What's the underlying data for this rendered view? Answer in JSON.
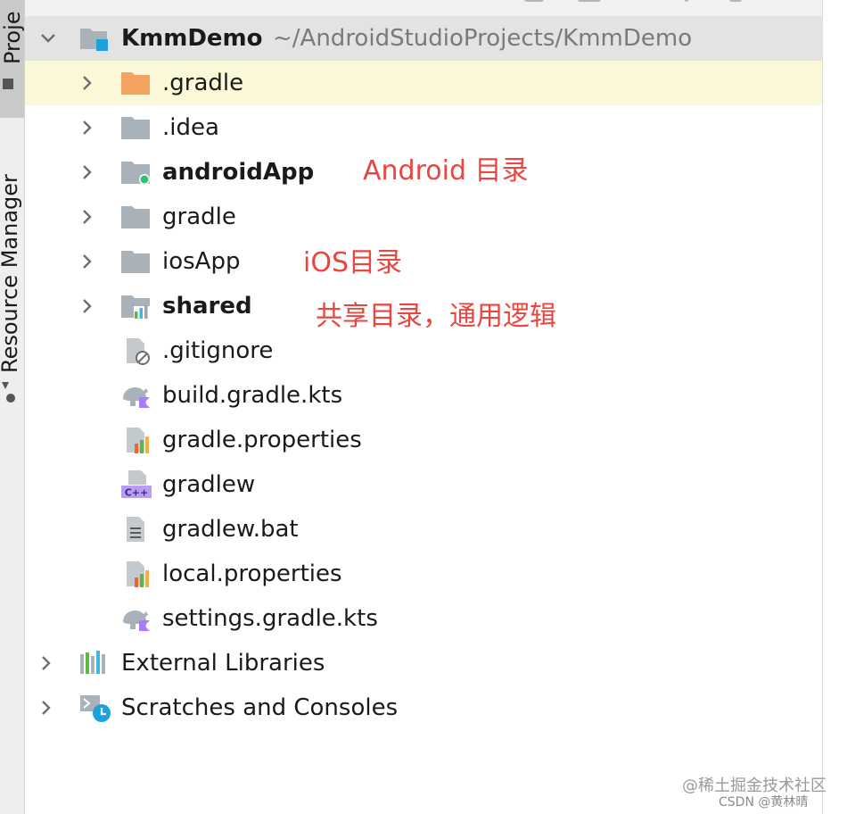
{
  "sidebar": {
    "project_tab": "Proje",
    "resource_manager_tab": "Resource Manager"
  },
  "tree": {
    "root": {
      "name": "KmmDemo",
      "path": "~/AndroidStudioProjects/KmmDemo"
    },
    "items": [
      {
        "label": ".gradle",
        "type": "folder-orange",
        "expandable": true,
        "bold": false
      },
      {
        "label": ".idea",
        "type": "folder",
        "expandable": true,
        "bold": false
      },
      {
        "label": "androidApp",
        "type": "folder-android-module",
        "expandable": true,
        "bold": true
      },
      {
        "label": "gradle",
        "type": "folder",
        "expandable": true,
        "bold": false
      },
      {
        "label": "iosApp",
        "type": "folder",
        "expandable": true,
        "bold": false
      },
      {
        "label": "shared",
        "type": "folder-module",
        "expandable": true,
        "bold": true
      },
      {
        "label": ".gitignore",
        "type": "file-ignore",
        "expandable": false,
        "bold": false
      },
      {
        "label": "build.gradle.kts",
        "type": "file-gradle-kts",
        "expandable": false,
        "bold": false
      },
      {
        "label": "gradle.properties",
        "type": "file-properties",
        "expandable": false,
        "bold": false
      },
      {
        "label": "gradlew",
        "type": "file-cpp",
        "expandable": false,
        "bold": false
      },
      {
        "label": "gradlew.bat",
        "type": "file-text",
        "expandable": false,
        "bold": false
      },
      {
        "label": "local.properties",
        "type": "file-properties",
        "expandable": false,
        "bold": false
      },
      {
        "label": "settings.gradle.kts",
        "type": "file-gradle-kts",
        "expandable": false,
        "bold": false
      }
    ],
    "external_libraries": "External Libraries",
    "scratches": "Scratches and Consoles"
  },
  "annotations": {
    "android": "Android 目录",
    "ios": "iOS目录",
    "shared": "共享目录，通用逻辑"
  },
  "watermark": {
    "line1": "@稀土掘金技术社区",
    "line2": "CSDN @黄林晴"
  },
  "colors": {
    "annotation": "#e8463f",
    "selected_row": "#fbf8d8",
    "root_row": "#e3e3e3",
    "folder": "#a9b1b9",
    "folder_orange": "#f4a460"
  }
}
